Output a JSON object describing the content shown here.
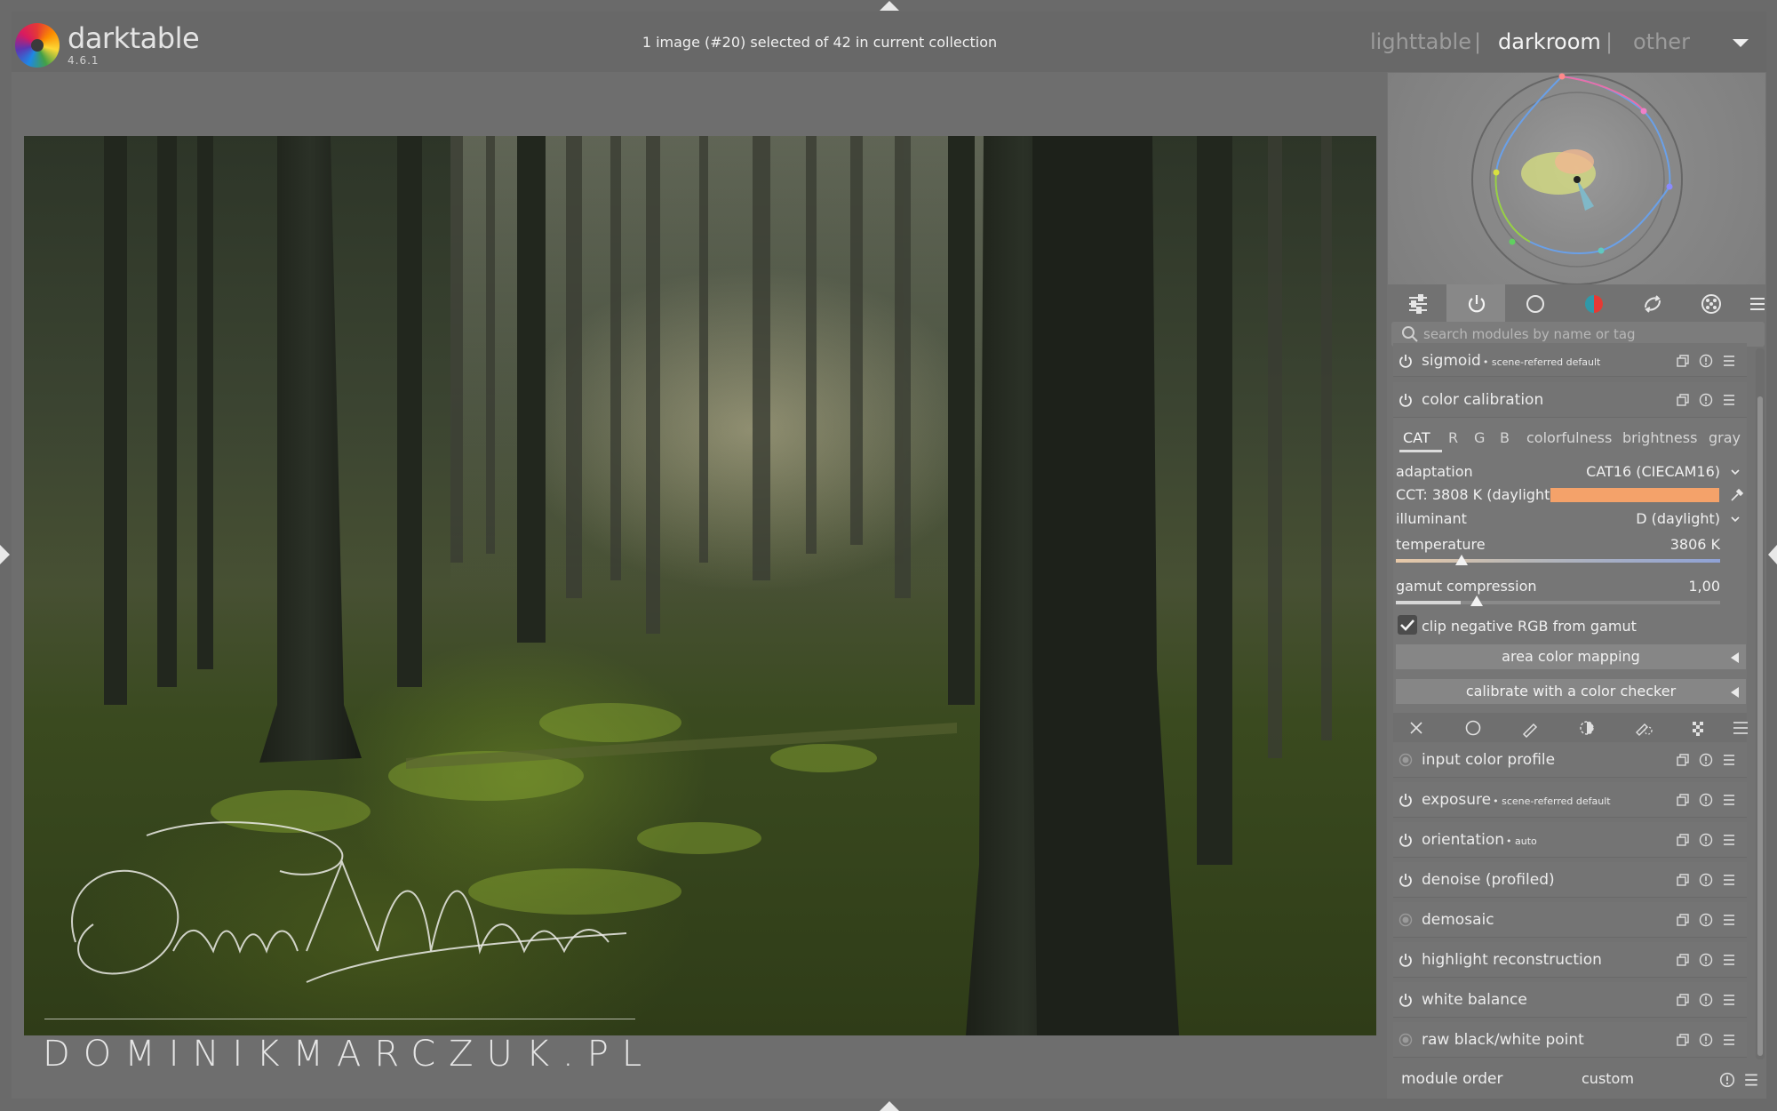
{
  "app": {
    "name": "darktable",
    "version": "4.6.1"
  },
  "header": {
    "status": "1 image (#20) selected of 42 in current collection",
    "views": [
      "lighttable",
      "darkroom",
      "other"
    ],
    "separator": "|",
    "active_view": "darkroom"
  },
  "watermark": {
    "url": "DOMINIKMARCZUK.PL"
  },
  "module_search": {
    "placeholder": "search modules by name or tag"
  },
  "module_groups": [
    "quick-access-icon",
    "active-modules-icon",
    "base-icon",
    "color-icon",
    "correct-icon",
    "effect-icon"
  ],
  "modules_top": [
    {
      "name": "sigmoid",
      "label": "• scene-referred default"
    },
    {
      "name": "color calibration",
      "label": ""
    }
  ],
  "color_calibration": {
    "tabs": [
      "CAT",
      "R",
      "G",
      "B",
      "colorfulness",
      "brightness",
      "gray"
    ],
    "active_tab": "CAT",
    "adaptation_label": "adaptation",
    "adaptation_value": "CAT16 (CIECAM16)",
    "cct_label": "CCT: 3808 K (daylight)",
    "cct_color": "#f4a26a",
    "illuminant_label": "illuminant",
    "illuminant_value": "D (daylight)",
    "temperature_label": "temperature",
    "temperature_value": "3806 K",
    "gamut_label": "gamut compression",
    "gamut_value": "1,00",
    "clip_label": "clip negative RGB from gamut",
    "clip_checked": true,
    "area_button": "area color mapping",
    "checker_button": "calibrate with a color checker"
  },
  "modules_bottom": [
    {
      "name": "input color profile",
      "label": "",
      "state": "always-on"
    },
    {
      "name": "exposure",
      "label": "• scene-referred default",
      "state": "on"
    },
    {
      "name": "orientation",
      "label": "• auto",
      "state": "on"
    },
    {
      "name": "denoise (profiled)",
      "label": "",
      "state": "on"
    },
    {
      "name": "demosaic",
      "label": "",
      "state": "always-on"
    },
    {
      "name": "highlight reconstruction",
      "label": "",
      "state": "on"
    },
    {
      "name": "white balance",
      "label": "",
      "state": "on"
    },
    {
      "name": "raw black/white point",
      "label": "",
      "state": "always-on"
    }
  ],
  "module_order": {
    "label": "module order",
    "value": "custom"
  }
}
